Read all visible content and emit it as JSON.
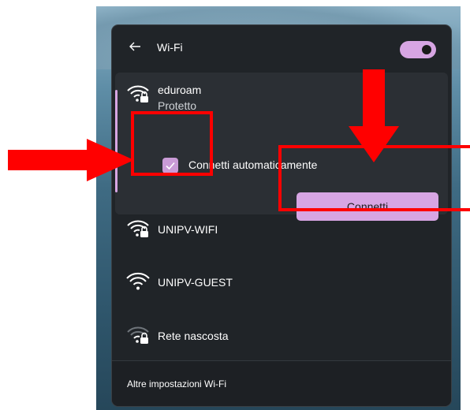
{
  "panel": {
    "title": "Wi-Fi",
    "wifi_toggle_on": true,
    "accent_color": "#d7a5e3"
  },
  "networks": [
    {
      "name": "eduroam",
      "status": "Protetto",
      "secured": true,
      "expanded": true,
      "auto_connect_label": "Connetti automaticamente",
      "auto_connect_checked": true,
      "connect_label": "Connetti"
    },
    {
      "name": "UNIPV-WIFI",
      "secured": true
    },
    {
      "name": "UNIPV-GUEST",
      "secured": false
    },
    {
      "name": "Rete nascosta",
      "secured": true,
      "weak": true
    }
  ],
  "footer": {
    "link_label": "Altre impostazioni Wi-Fi"
  },
  "annotations": {
    "color": "#ff0000"
  }
}
